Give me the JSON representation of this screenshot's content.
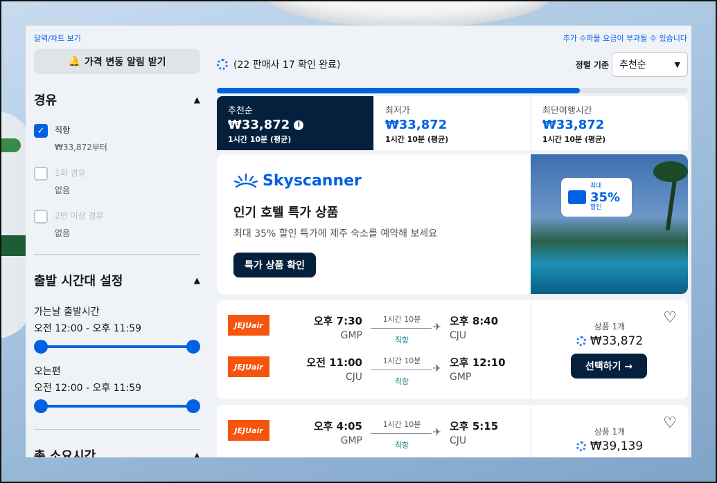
{
  "header": {
    "calendar_link": "달력/차트 보기",
    "fees_note": "추가 수하물 요금이 부과될 수 있습니다"
  },
  "sidebar": {
    "alert_button": "가격 변동 알림 받기",
    "stops_section": {
      "title": "경유",
      "options": [
        {
          "label": "직항",
          "sub": "₩33,872부터",
          "checked": true,
          "enabled": true
        },
        {
          "label": "1회 경유",
          "sub": "없음",
          "checked": false,
          "enabled": false
        },
        {
          "label": "2번 이상 경유",
          "sub": "없음",
          "checked": false,
          "enabled": false
        }
      ]
    },
    "time_section": {
      "title": "출발 시간대 설정",
      "outbound_label": "가는날 출발시간",
      "outbound_range": "오전 12:00 - 오후 11:59",
      "return_label": "오는편",
      "return_range": "오전 12:00 - 오후 11:59"
    },
    "duration_section": {
      "title": "총 소요시간"
    }
  },
  "main": {
    "status_text": "(22 판매사 17 확인 완료)",
    "sort_label": "정렬 기준",
    "sort_value": "추천순",
    "progress_fraction": 0.77,
    "tabs": [
      {
        "name": "추천순",
        "price": "₩33,872",
        "sub": "1시간 10분 (평균)",
        "active": true
      },
      {
        "name": "최저가",
        "price": "₩33,872",
        "sub": "1시간 10분 (평균)",
        "active": false
      },
      {
        "name": "최단여행시간",
        "price": "₩33,872",
        "sub": "1시간 10분 (평균)",
        "active": false
      }
    ],
    "ad": {
      "brand": "Skyscanner",
      "title": "인기 호텔 특가 상품",
      "desc": "최대 35% 할인 특가에 제주 숙소를 예약해 보세요",
      "button": "특가 상품 확인",
      "badge_top": "최대",
      "badge_pct": "35%",
      "badge_bottom": "할인"
    },
    "flights": [
      {
        "legs": [
          {
            "airline": "JEJUair",
            "dep_time": "오후 7:30",
            "dep_code": "GMP",
            "duration": "1시간 10분",
            "stops": "직항",
            "arr_time": "오후 8:40",
            "arr_code": "CJU"
          },
          {
            "airline": "JEJUair",
            "dep_time": "오전 11:00",
            "dep_code": "CJU",
            "duration": "1시간 10분",
            "stops": "직항",
            "arr_time": "오후 12:10",
            "arr_code": "GMP"
          }
        ],
        "deal_count": "상품 1개",
        "price": "₩33,872",
        "select_label": "선택하기 →"
      },
      {
        "legs": [
          {
            "airline": "JEJUair",
            "dep_time": "오후 4:05",
            "dep_code": "GMP",
            "duration": "1시간 10분",
            "stops": "직항",
            "arr_time": "오후 5:15",
            "arr_code": "CJU"
          }
        ],
        "deal_count": "상품 1개",
        "price": "₩39,139"
      }
    ]
  },
  "colors": {
    "accent": "#0062e3",
    "dark": "#05203c",
    "airline_orange": "#f5550f"
  }
}
